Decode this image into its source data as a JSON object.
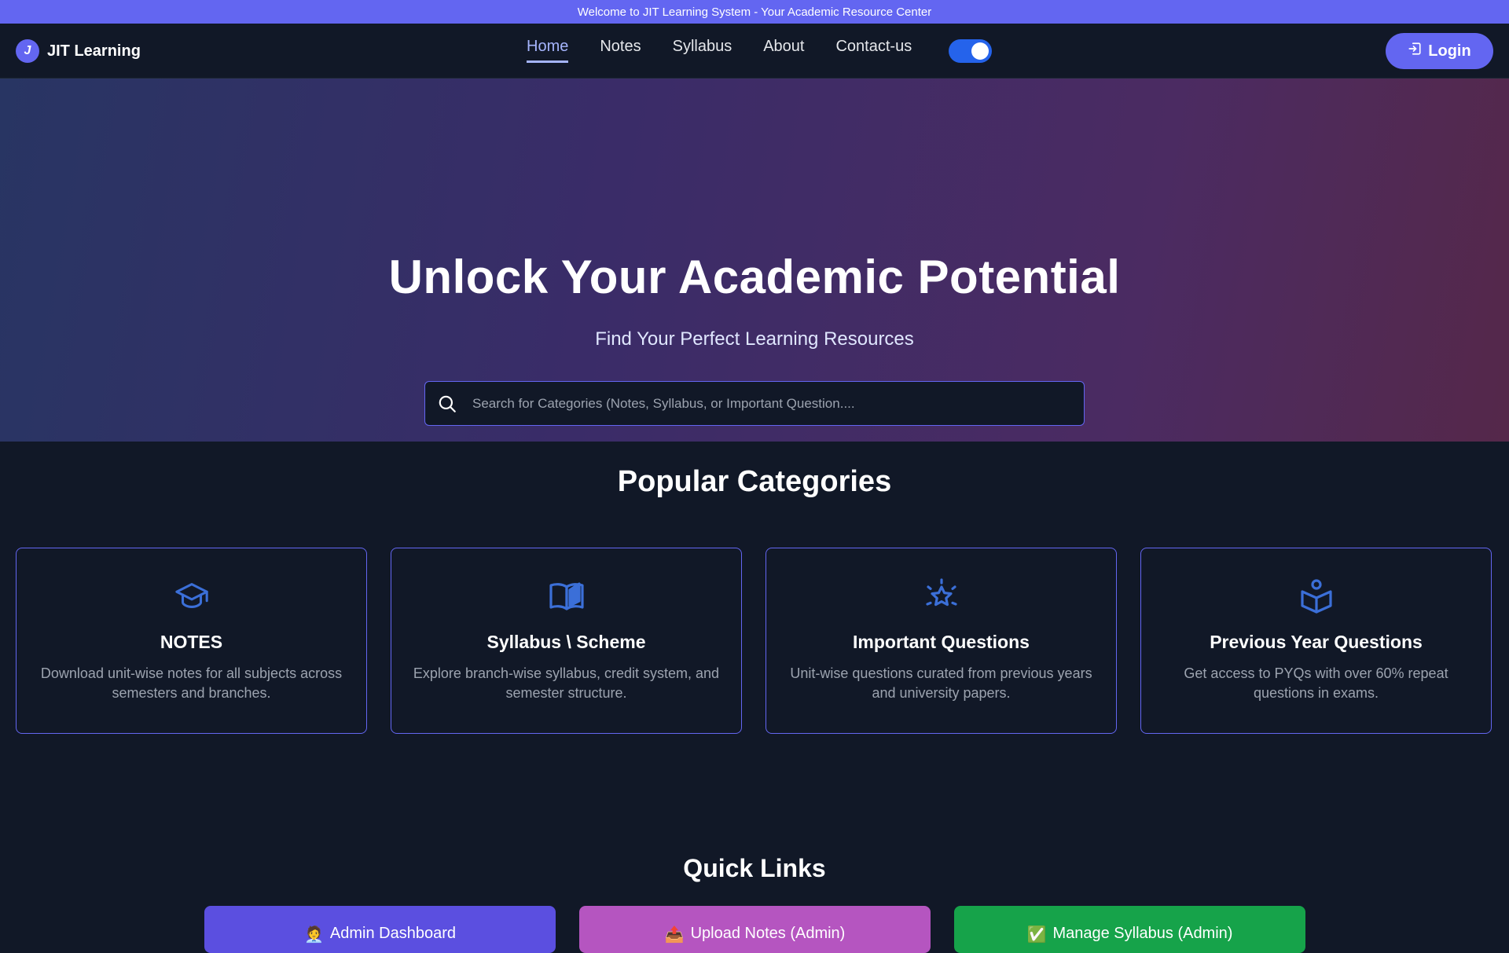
{
  "announcement": "Welcome to JIT Learning System - Your Academic Resource Center",
  "brand": {
    "logo_letter": "J",
    "name": "JIT Learning"
  },
  "nav": {
    "items": [
      {
        "label": "Home",
        "active": true
      },
      {
        "label": "Notes",
        "active": false
      },
      {
        "label": "Syllabus",
        "active": false
      },
      {
        "label": "About",
        "active": false
      },
      {
        "label": "Contact-us",
        "active": false
      }
    ],
    "theme_toggle_on": true,
    "login_label": "Login",
    "login_icon": "login-icon"
  },
  "hero": {
    "title": "Unlock Your Academic Potential",
    "subtitle": "Find Your Perfect Learning Resources",
    "search_placeholder": "Search for Categories (Notes, Syllabus, or Important Question....",
    "search_value": ""
  },
  "categories": {
    "title": "Popular Categories",
    "items": [
      {
        "icon": "graduation-cap-icon",
        "title": "NOTES",
        "desc": "Download unit-wise notes for all subjects across semesters and branches."
      },
      {
        "icon": "open-book-icon",
        "title": "Syllabus \\ Scheme",
        "desc": "Explore branch-wise syllabus, credit system, and semester structure."
      },
      {
        "icon": "star-icon",
        "title": "Important Questions",
        "desc": "Unit-wise questions curated from previous years and university papers."
      },
      {
        "icon": "reader-icon",
        "title": "Previous Year Questions",
        "desc": "Get access to PYQs with over 60% repeat questions in exams."
      }
    ]
  },
  "quick_links": {
    "title": "Quick Links",
    "items": [
      {
        "emoji": "🧑‍💼",
        "label": "Admin Dashboard",
        "color": "#5b4fe0"
      },
      {
        "emoji": "📤",
        "label": "Upload Notes (Admin)",
        "color": "#b555c0"
      },
      {
        "emoji": "✅",
        "label": "Manage Syllabus (Admin)",
        "color": "#16a34a"
      }
    ]
  },
  "colors": {
    "accent": "#6366f1",
    "background": "#111827",
    "icon_blue": "#3b6fd8"
  }
}
